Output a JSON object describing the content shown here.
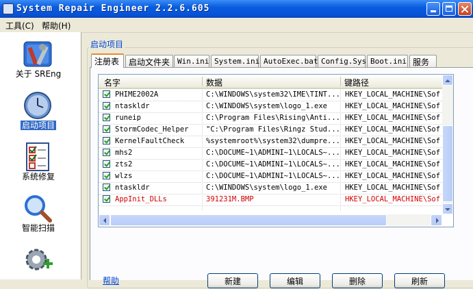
{
  "window": {
    "title": "System Repair Engineer 2.2.6.605"
  },
  "menu": [
    "工具(C)",
    "帮助(H)"
  ],
  "sidebar": [
    {
      "label": "关于 SREng",
      "icon": "tools-icon"
    },
    {
      "label": "启动项目",
      "icon": "clock-icon",
      "active": true
    },
    {
      "label": "系统修复",
      "icon": "checklist-icon"
    },
    {
      "label": "智能扫描",
      "icon": "magnifier-icon"
    },
    {
      "label": "",
      "icon": "gear-plus-icon"
    }
  ],
  "group_title": "启动项目",
  "tabs": [
    "注册表",
    "启动文件夹",
    "Win.ini",
    "System.ini",
    "AutoExec.bat",
    "Config.Sys",
    "Boot.ini",
    "服务"
  ],
  "active_tab": 0,
  "table": {
    "columns": [
      "名字",
      "数据",
      "键路径"
    ],
    "rows": [
      {
        "checked": true,
        "name": "PHIME2002A",
        "data": "C:\\WINDOWS\\system32\\IME\\TINT...",
        "path": "HKEY_LOCAL_MACHINE\\Sof"
      },
      {
        "checked": true,
        "name": "ntaskldr",
        "data": "C:\\WINDOWS\\system\\logo_1.exe",
        "path": "HKEY_LOCAL_MACHINE\\Sof"
      },
      {
        "checked": true,
        "name": "runeip",
        "data": "C:\\Program Files\\Rising\\Anti...",
        "path": "HKEY_LOCAL_MACHINE\\Sof"
      },
      {
        "checked": true,
        "name": "StormCodec_Helper",
        "data": "\"C:\\Program Files\\Ringz Stud...",
        "path": "HKEY_LOCAL_MACHINE\\Sof"
      },
      {
        "checked": true,
        "name": "KernelFaultCheck",
        "data": "%systemroot%\\system32\\dumpre...",
        "path": "HKEY_LOCAL_MACHINE\\Sof"
      },
      {
        "checked": true,
        "name": "mhs2",
        "data": "C:\\DOCUME~1\\ADMINI~1\\LOCALS~...",
        "path": "HKEY_LOCAL_MACHINE\\Sof"
      },
      {
        "checked": true,
        "name": "zts2",
        "data": "C:\\DOCUME~1\\ADMINI~1\\LOCALS~...",
        "path": "HKEY_LOCAL_MACHINE\\Sof"
      },
      {
        "checked": true,
        "name": "wlzs",
        "data": "C:\\DOCUME~1\\ADMINI~1\\LOCALS~...",
        "path": "HKEY_LOCAL_MACHINE\\Sof"
      },
      {
        "checked": true,
        "name": "ntaskldr",
        "data": "C:\\WINDOWS\\system\\logo_1.exe",
        "path": "HKEY_LOCAL_MACHINE\\Sof"
      },
      {
        "checked": true,
        "name": "AppInit_DLLs",
        "data": "391231M.BMP",
        "path": "HKEY_LOCAL_MACHINE\\Sof",
        "highlight": "#d00000"
      }
    ]
  },
  "buttons": [
    "新建",
    "编辑",
    "删除",
    "刷新"
  ],
  "help_link": "帮助",
  "colors": {
    "title_bar": "#0a5de0",
    "accent_text": "#0046d5",
    "highlight_row": "#d00000",
    "selection": "#316ac5"
  }
}
